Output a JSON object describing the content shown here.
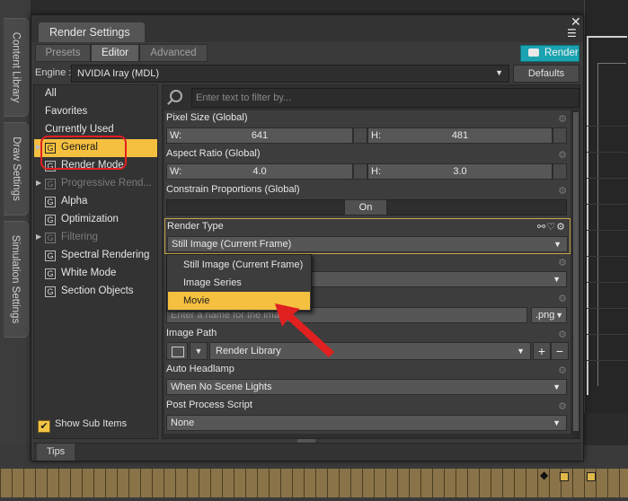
{
  "side_tabs": [
    "Content Library",
    "Draw Settings",
    "Simulation Settings"
  ],
  "dialog": {
    "title": "Render Settings",
    "close_glyph": "✕",
    "menu_glyph": "☰",
    "tabs": [
      {
        "label": "Presets",
        "active": false
      },
      {
        "label": "Editor",
        "active": true
      },
      {
        "label": "Advanced",
        "active": false
      }
    ],
    "render_button": "Render",
    "engine_label": "Engine :",
    "engine_value": "NVIDIA Iray (MDL)",
    "defaults_button": "Defaults"
  },
  "nav": {
    "items": [
      {
        "label": "All",
        "icon": false,
        "expand": false,
        "state": "normal"
      },
      {
        "label": "Favorites",
        "icon": false,
        "expand": false,
        "state": "normal"
      },
      {
        "label": "Currently Used",
        "icon": false,
        "expand": false,
        "state": "normal"
      },
      {
        "label": "General",
        "icon": true,
        "expand": true,
        "state": "selected"
      },
      {
        "label": "Render Mode",
        "icon": true,
        "expand": false,
        "state": "normal"
      },
      {
        "label": "Progressive Rend...",
        "icon": true,
        "expand": true,
        "state": "dim"
      },
      {
        "label": "Alpha",
        "icon": true,
        "expand": false,
        "state": "normal"
      },
      {
        "label": "Optimization",
        "icon": true,
        "expand": false,
        "state": "normal"
      },
      {
        "label": "Filtering",
        "icon": true,
        "expand": true,
        "state": "dim"
      },
      {
        "label": "Spectral Rendering",
        "icon": true,
        "expand": false,
        "state": "normal"
      },
      {
        "label": "White Mode",
        "icon": true,
        "expand": false,
        "state": "normal"
      },
      {
        "label": "Section Objects",
        "icon": true,
        "expand": false,
        "state": "normal"
      }
    ],
    "icon_letter": "G",
    "show_sub_items": "Show Sub Items",
    "show_sub_items_checked": true
  },
  "search": {
    "placeholder": "Enter text to filter by..."
  },
  "props": {
    "pixel_size": {
      "title": "Pixel Size (Global)",
      "w_label": "W:",
      "w_value": "641",
      "h_label": "H:",
      "h_value": "481"
    },
    "aspect_ratio": {
      "title": "Aspect Ratio (Global)",
      "w_label": "W:",
      "w_value": "4.0",
      "h_label": "H:",
      "h_value": "3.0"
    },
    "constrain": {
      "title": "Constrain Proportions (Global)",
      "value": "On"
    },
    "render_type": {
      "title": "Render Type",
      "value": "Still Image (Current Frame)",
      "icons": "⚯♡⚙"
    },
    "filename": {
      "placeholder": "Enter a name for the image",
      "ext": ".png"
    },
    "image_path": {
      "title": "Image Path",
      "value": "Render Library",
      "plus": "+",
      "minus": "−"
    },
    "auto_headlamp": {
      "title": "Auto Headlamp",
      "value": "When No Scene Lights"
    },
    "post_process": {
      "title": "Post Process Script",
      "value": "None"
    }
  },
  "render_type_popup": {
    "options": [
      {
        "label": "Still Image (Current Frame)",
        "highlighted": false
      },
      {
        "label": "Image Series",
        "highlighted": false
      },
      {
        "label": "Movie",
        "highlighted": true
      }
    ]
  },
  "tips_tab": "Tips",
  "colors": {
    "accent": "#f5c040",
    "render_button": "#1aa3b0",
    "annotation": "#e12020"
  }
}
